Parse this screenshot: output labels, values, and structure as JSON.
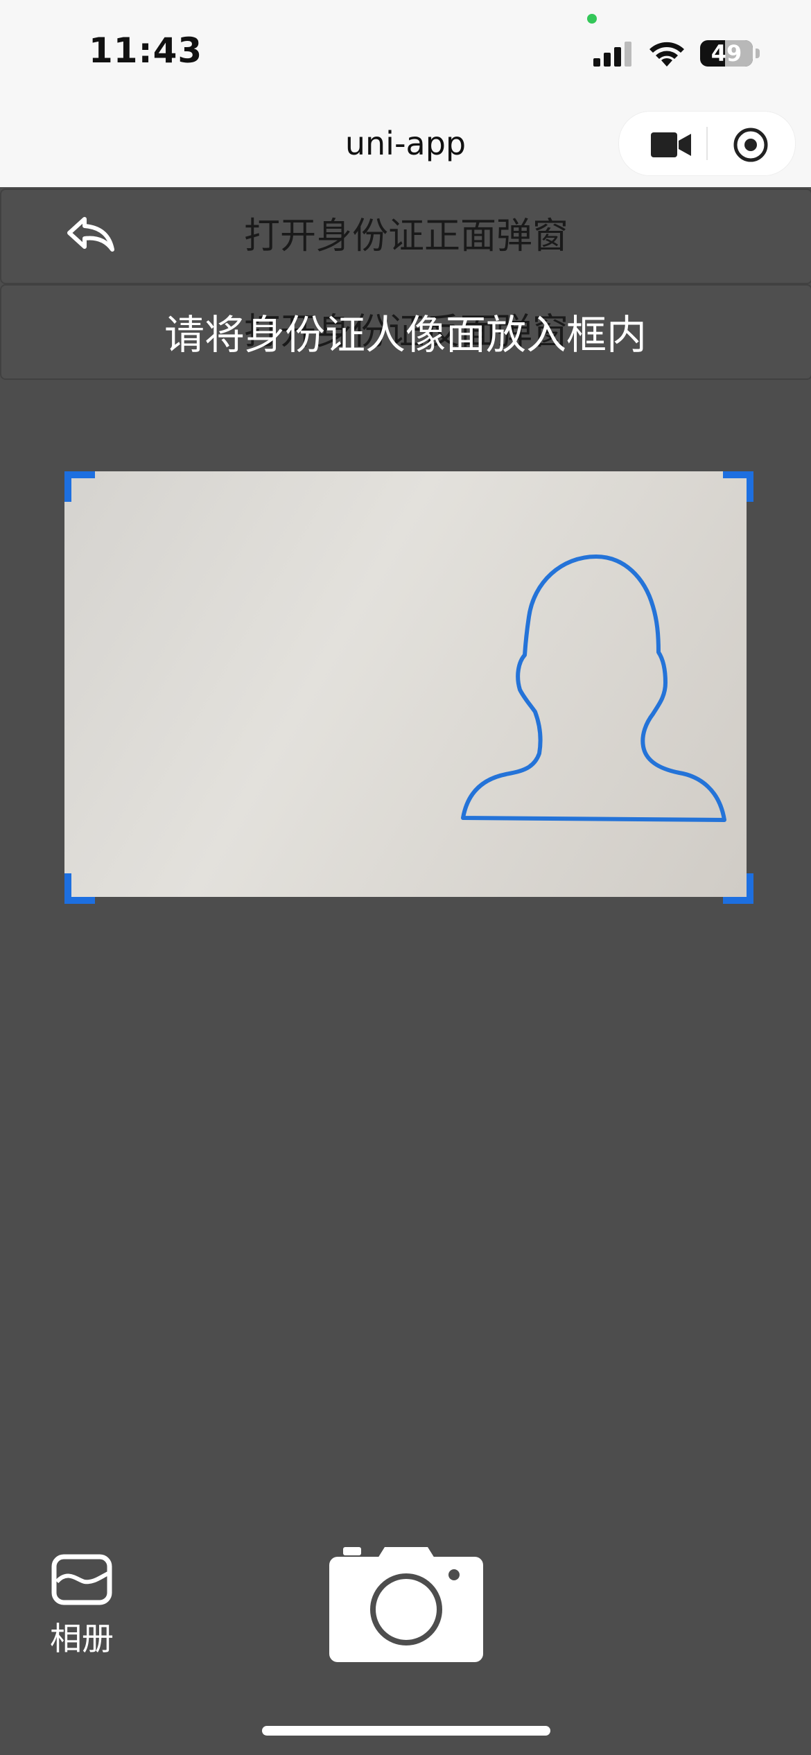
{
  "status_bar": {
    "time": "11:43",
    "battery": "49"
  },
  "nav": {
    "title": "uni-app"
  },
  "buttons": {
    "open_front": "打开身份证正面弹窗",
    "open_back": "打开身份证反面弹窗"
  },
  "camera": {
    "hint": "请将身份证人像面放入框内",
    "album_label": "相册"
  },
  "colors": {
    "accent": "#1d6fe0",
    "background": "#4d4d4d"
  }
}
